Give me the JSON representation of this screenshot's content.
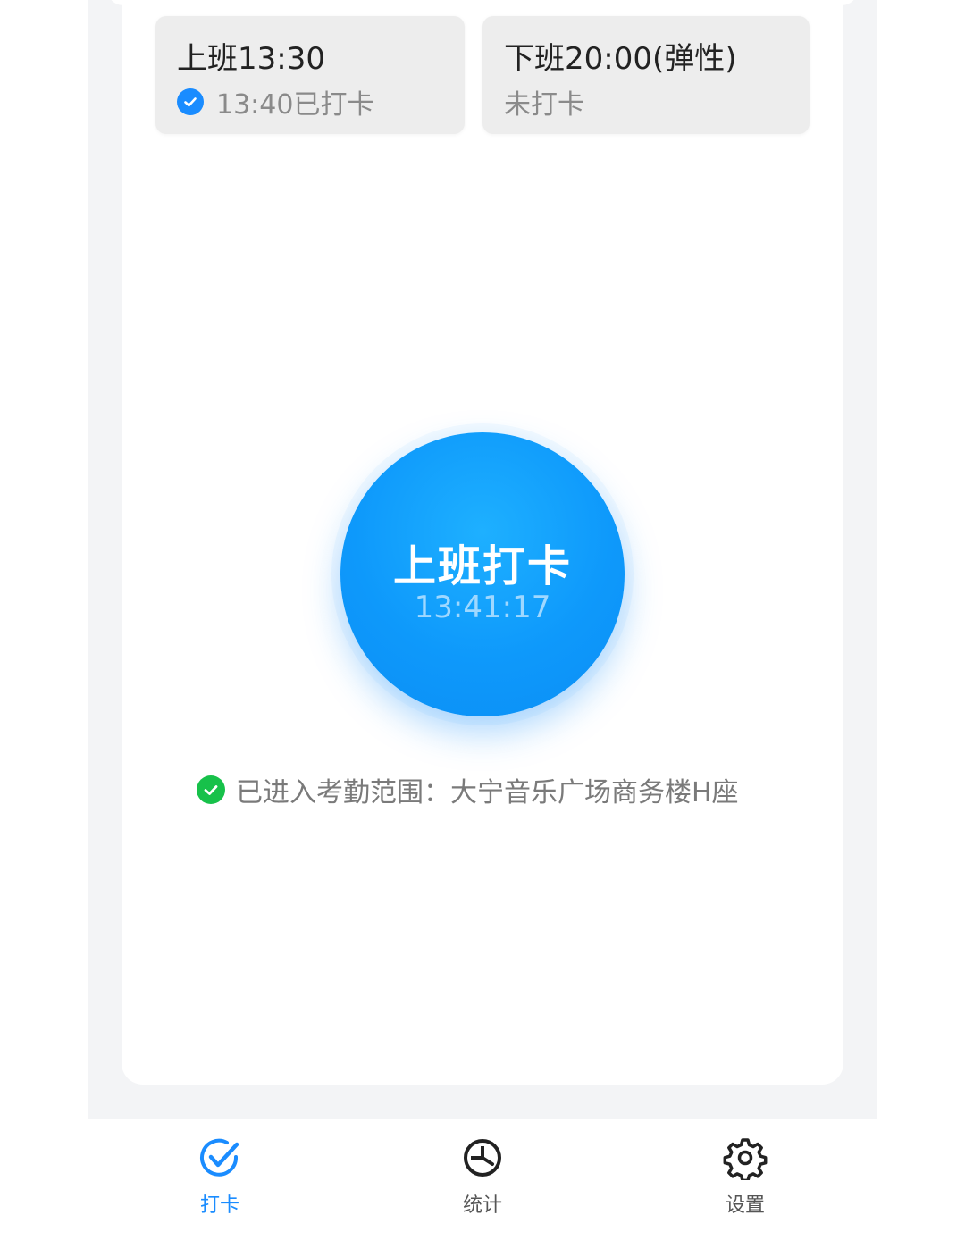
{
  "shifts": {
    "clock_in": {
      "title": "上班13:30",
      "status": "13:40已打卡"
    },
    "clock_out": {
      "title": "下班20:00(弹性)",
      "status": "未打卡"
    }
  },
  "punch": {
    "label": "上班打卡",
    "time": "13:41:17"
  },
  "location": {
    "text": "已进入考勤范围：大宁音乐广场商务楼H座"
  },
  "tabs": [
    {
      "label": "打卡",
      "icon": "check-badge-icon",
      "active": true
    },
    {
      "label": "统计",
      "icon": "pie-chart-icon",
      "active": false
    },
    {
      "label": "设置",
      "icon": "gear-icon",
      "active": false
    }
  ],
  "colors": {
    "accent": "#1a8cff",
    "success": "#17c14a"
  }
}
